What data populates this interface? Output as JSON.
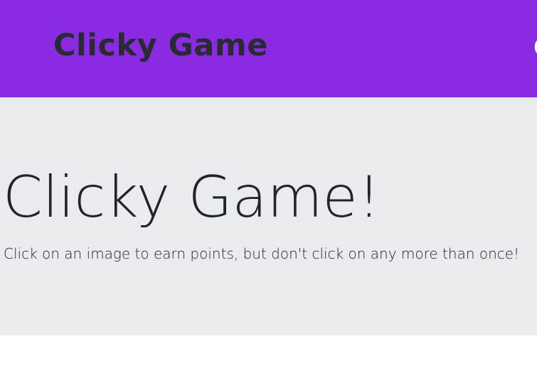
{
  "navbar": {
    "brand": "Clicky Game",
    "right_text_partial": "C"
  },
  "jumbotron": {
    "title": "Clicky Game!",
    "lead": "Click on an image to earn points, but don't click on any more than once!"
  },
  "colors": {
    "navbar_bg": "#8a2be2",
    "jumbotron_bg": "#e9ecef",
    "text": "#212529"
  }
}
